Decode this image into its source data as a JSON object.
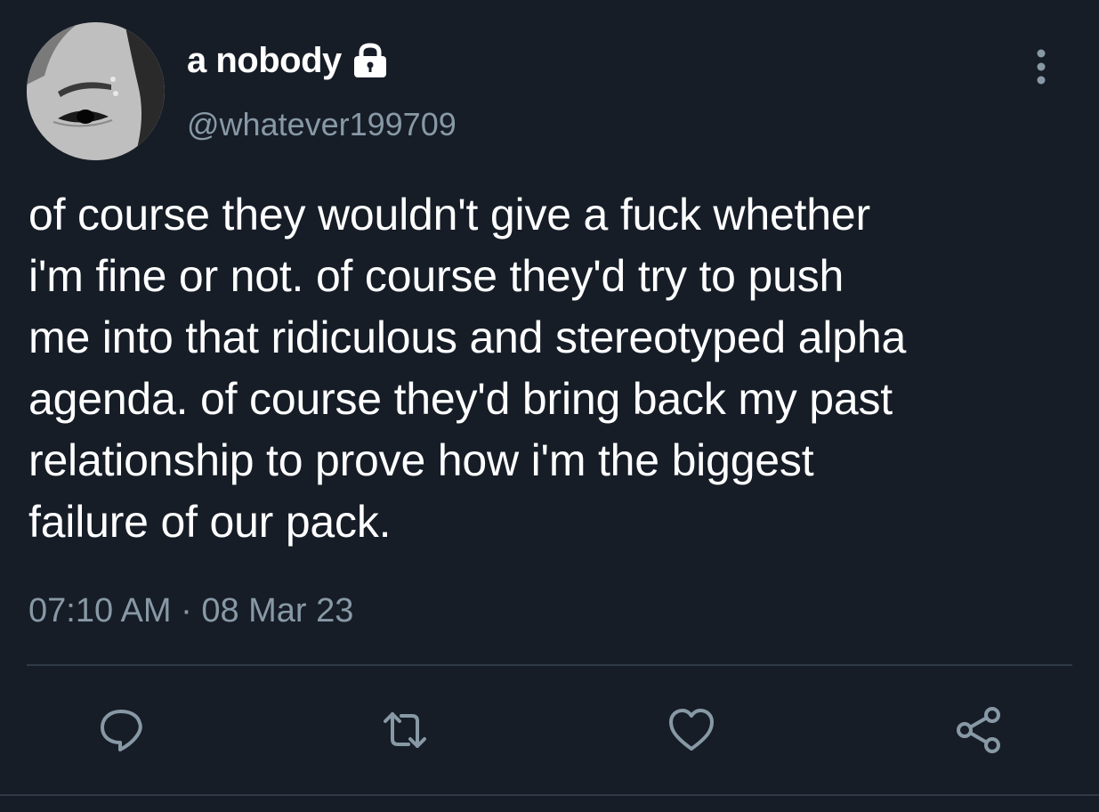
{
  "user": {
    "display_name": "a nobody",
    "handle": "@whatever199709",
    "protected_icon": "lock-icon",
    "avatar_icon": "profile-photo"
  },
  "tweet": {
    "text": "of course they wouldn't give a fuck whether\ni'm fine or not. of course they'd try to push\nme into that ridiculous and stereotyped alpha\nagenda. of course they'd bring back my past\nrelationship to prove how i'm the biggest\nfailure of our pack.",
    "timestamp": "07:10 AM · 08 Mar 23"
  },
  "actions": {
    "reply_icon": "reply-icon",
    "retweet_icon": "retweet-icon",
    "like_icon": "heart-icon",
    "share_icon": "share-icon",
    "more_icon": "more-vertical-icon"
  },
  "colors": {
    "background": "#161d27",
    "text_primary": "#ffffff",
    "text_secondary": "#8899a6",
    "divider": "#2f3a46"
  }
}
